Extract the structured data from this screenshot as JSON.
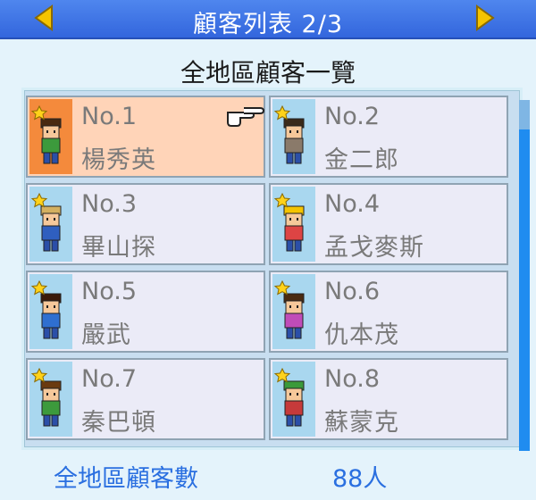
{
  "header": {
    "title": "顧客列表 2/3"
  },
  "subtitle": "全地區顧客一覽",
  "customers": [
    {
      "no": "No.1",
      "name": "楊秀英",
      "selected": true
    },
    {
      "no": "No.2",
      "name": "金二郎",
      "selected": false
    },
    {
      "no": "No.3",
      "name": "畢山探",
      "selected": false
    },
    {
      "no": "No.4",
      "name": "孟戈麥斯",
      "selected": false
    },
    {
      "no": "No.5",
      "name": "嚴武",
      "selected": false
    },
    {
      "no": "No.6",
      "name": "仇本茂",
      "selected": false
    },
    {
      "no": "No.7",
      "name": "秦巴頓",
      "selected": false
    },
    {
      "no": "No.8",
      "name": "蘇蒙克",
      "selected": false
    }
  ],
  "footer": {
    "label": "全地區顧客數",
    "value": "88人"
  },
  "colors": {
    "header_bg": "#3f78e8",
    "arrow": "#f5c400",
    "selected_card": "#ffd4b8",
    "card": "#ebebf7",
    "footer_text": "#2a6fe0"
  },
  "icons": [
    "arrow-left-icon",
    "arrow-right-icon",
    "pointing-hand-icon",
    "star-icon"
  ]
}
